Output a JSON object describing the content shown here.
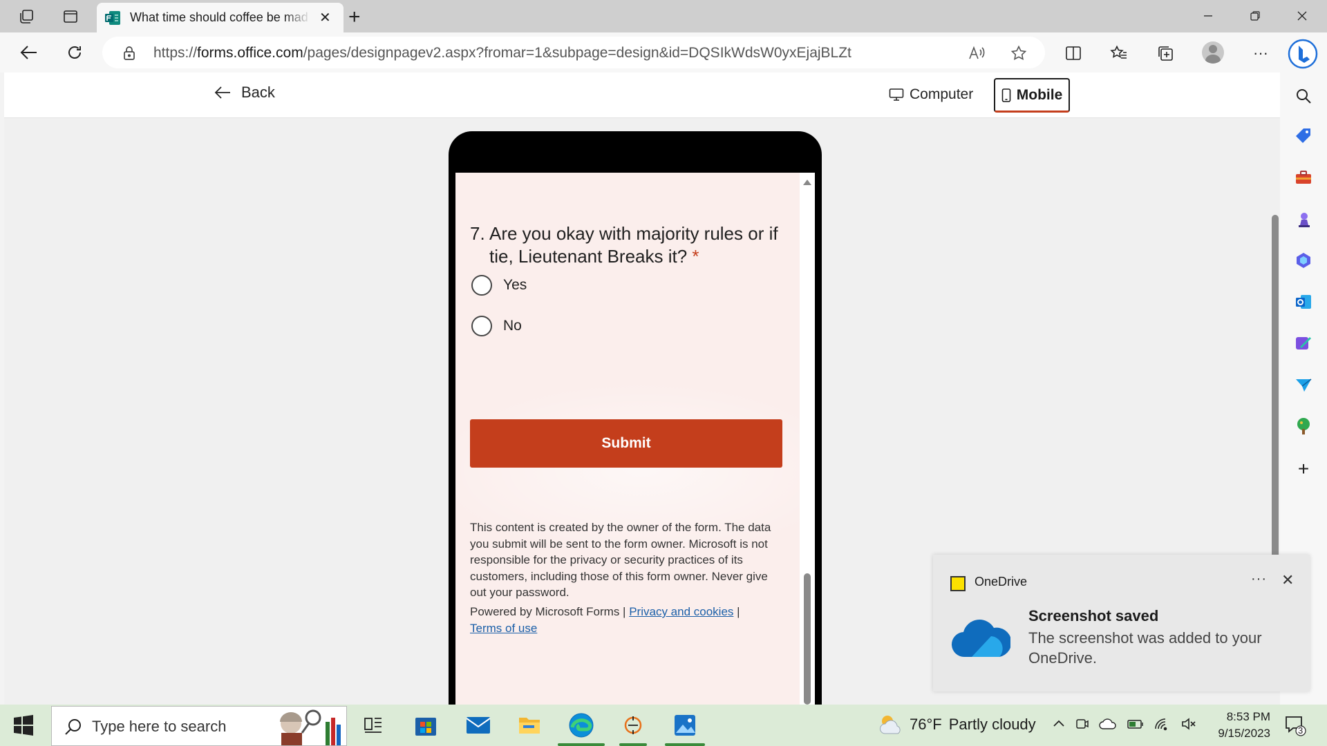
{
  "browser": {
    "tab_title": "What time should coffee be mad",
    "url_prefix": "https://",
    "url_host": "forms.office.com",
    "url_path": "/pages/designpagev2.aspx?fromar=1&subpage=design&id=DQSIkWdsW0yxEjajBLZtrQAAAAAAAA..."
  },
  "preview": {
    "back_label": "Back",
    "computer_label": "Computer",
    "mobile_label": "Mobile"
  },
  "form": {
    "question_number": "7.",
    "question_text": "Are you okay with majority rules or if tie, Lieutenant Breaks it?",
    "required_marker": "*",
    "options": [
      "Yes",
      "No"
    ],
    "submit_label": "Submit",
    "disclaimer": "This content is created by the owner of the form. The data you submit will be sent to the form owner. Microsoft is not responsible for the privacy or security practices of its customers, including those of this form owner. Never give out your password.",
    "powered_by": "Powered by Microsoft Forms |",
    "privacy_link": "Privacy and cookies",
    "separator": "|",
    "terms_link": "Terms of use"
  },
  "notification": {
    "app_name": "OneDrive",
    "more": "···",
    "title": "Screenshot saved",
    "body": "The screenshot was added to your OneDrive."
  },
  "taskbar": {
    "search_placeholder": "Type here to search",
    "weather_temp": "76°F",
    "weather_desc": "Partly cloudy",
    "time": "8:53 PM",
    "date": "9/15/2023",
    "notif_count": "3"
  },
  "colors": {
    "accent": "#c43e1c",
    "form_bg": "#fbeeec",
    "link": "#1b5fa8",
    "taskbar": "#dcebd7"
  }
}
